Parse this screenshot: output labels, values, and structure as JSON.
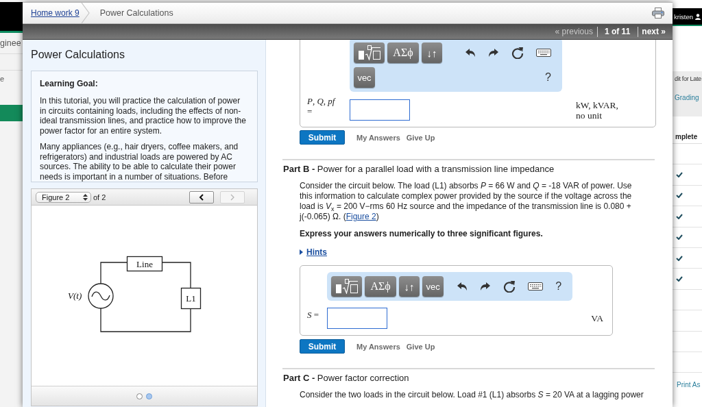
{
  "background_page": {
    "heading_fragment": "ginee",
    "menu_fragment": "e",
    "user": "kristen",
    "column_fragment": "dit for Late",
    "grading_link": "Grading",
    "column_header": "mplete",
    "rows": [
      {
        "complete": false
      },
      {
        "complete": true
      },
      {
        "complete": true
      },
      {
        "complete": true
      },
      {
        "complete": true
      },
      {
        "complete": true
      },
      {
        "complete": true
      },
      {
        "complete": false
      },
      {
        "complete": false
      },
      {
        "complete": false
      },
      {
        "complete": false
      }
    ],
    "print_link": "Print As"
  },
  "dialog": {
    "breadcrumb": [
      {
        "label": "Home work 9",
        "link": true
      },
      {
        "label": "Power Calculations",
        "link": false
      }
    ],
    "pager": {
      "previous": {
        "label": "« previous",
        "disabled": true
      },
      "position": "1 of 11",
      "next": {
        "label": "next »",
        "disabled": false
      }
    },
    "intro": {
      "title": "Power Calculations",
      "heading": "Learning Goal:",
      "paragraphs": [
        "In this tutorial, you will practice the calculation of power in circuits containing loads, including the effects of non-ideal transmission lines, and practice how to improve the power factor for an entire system.",
        "Many appliances (e.g., hair dryers, coffee makers, and refrigerators) and industrial loads are powered by AC sources. The ability to be able to calculate their power needs is important in a number of situations. Before"
      ]
    },
    "figure_viewer": {
      "figure": "Figure 2",
      "count": "of 2",
      "buttons": [
        {
          "kind": "previous",
          "disabled": false
        },
        {
          "kind": "next",
          "disabled": true
        }
      ],
      "circuit": {
        "source": "V(t)",
        "line": "Line",
        "load": "L1"
      },
      "pages": [
        {
          "selected": false
        },
        {
          "selected": true
        }
      ]
    },
    "parts": [
      {
        "toolbar": [
          {
            "groups": [
              [
                {
                  "kind": "template"
                },
                {
                  "kind": "greek",
                  "label": "ΑΣϕ"
                },
                {
                  "kind": "arrows",
                  "label": "↓↑"
                }
              ],
              [
                {
                  "kind": "undo"
                },
                {
                  "kind": "redo"
                },
                {
                  "kind": "reset"
                },
                {
                  "kind": "keyboard"
                }
              ]
            ]
          },
          {
            "groups": [
              [
                {
                  "kind": "vector",
                  "label": "vec"
                }
              ],
              [
                {
                  "kind": "help",
                  "label": "?"
                }
              ]
            ]
          }
        ],
        "answer": {
          "label": "*P*, *Q*, *pf* =",
          "units": "kW, kVAR, no unit"
        },
        "actions": [
          {
            "kind": "submit",
            "label": "Submit"
          },
          {
            "kind": "my_answers",
            "label": "My Answers"
          },
          {
            "kind": "give_up",
            "label": "Give Up"
          }
        ]
      },
      {
        "heading": "**Part B -** Power for a parallel load with a transmission line impedance",
        "problem": {
          "text": "Consider the circuit below. The load (L1) absorbs *P* = 66 W and *Q* = -18 VAR of power. Use this information to calculate complex power provided by the source if the voltage across the load is *V*$_{x}$ = 200 V−rms 60 Hz source and the impedance of the transmission line is 0.080 + j(-0.065) Ω. (",
          "link": "Figure 2",
          "after": ")"
        },
        "instruction": "Express your answers numerically to three significant figures.",
        "hints": "Hints",
        "toolbar": [
          {
            "groups": [
              [
                {
                  "kind": "template"
                },
                {
                  "kind": "greek",
                  "label": "ΑΣϕ"
                },
                {
                  "kind": "arrows",
                  "label": "↓↑"
                },
                {
                  "kind": "vector",
                  "label": "vec"
                }
              ],
              [
                {
                  "kind": "undo"
                },
                {
                  "kind": "redo"
                },
                {
                  "kind": "reset"
                },
                {
                  "kind": "keyboard"
                },
                {
                  "kind": "help",
                  "label": "?"
                }
              ]
            ]
          }
        ],
        "answer": {
          "label": "*S* =",
          "units": "VA"
        },
        "actions": [
          {
            "kind": "submit",
            "label": "Submit"
          },
          {
            "kind": "my_answers",
            "label": "My Answers"
          },
          {
            "kind": "give_up",
            "label": "Give Up"
          }
        ]
      },
      {
        "heading": "**Part C -** Power factor correction",
        "problem": {
          "text": "Consider the two loads in the circuit below. Load #1 (L1) absorbs *S* = 20 VA at a lagging power"
        }
      }
    ]
  }
}
